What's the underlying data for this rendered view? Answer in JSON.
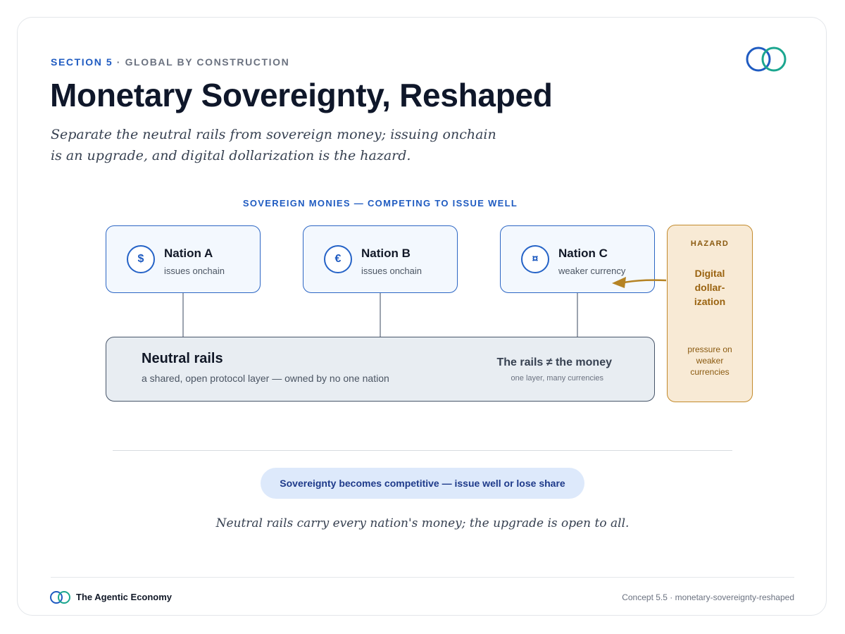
{
  "header": {
    "section": "SECTION 5",
    "separator": " · ",
    "section_name": "GLOBAL BY CONSTRUCTION",
    "title": "Monetary Sovereignty, Reshaped",
    "subtitle": "Separate the neutral rails from sovereign money; issuing onchain is an upgrade, and digital dollarization is the hazard."
  },
  "diagram": {
    "group_label": "SOVEREIGN MONIES — COMPETING TO ISSUE WELL",
    "nations": [
      {
        "symbol": "$",
        "name": "Nation A",
        "desc": "issues onchain"
      },
      {
        "symbol": "€",
        "name": "Nation B",
        "desc": "issues onchain"
      },
      {
        "symbol": "¤",
        "name": "Nation C",
        "desc": "weaker currency"
      }
    ],
    "rails": {
      "title": "Neutral rails",
      "desc": "a shared, open protocol layer — owned by no one nation",
      "note": "The rails ≠ the money",
      "note_sub": "one layer, many currencies"
    },
    "hazard": {
      "label": "HAZARD",
      "title": "Digital dollar-ization",
      "desc": "pressure on weaker currencies"
    }
  },
  "takeaway": {
    "pill": "Sovereignty becomes competitive — issue well or lose share",
    "closing": "Neutral rails carry every nation's money; the upgrade is open to all."
  },
  "footer": {
    "brand": "The Agentic Economy",
    "ref": "Concept 5.5 · monetary-sovereignty-reshaped"
  },
  "colors": {
    "accent_blue": "#1f5bc1",
    "accent_teal": "#1ba68f",
    "hazard_amber": "#c28a2c",
    "rails_slate": "#475569"
  },
  "icons": [
    "interlocking-rings-logo-icon",
    "dollar-coin-icon",
    "euro-coin-icon",
    "currency-coin-icon",
    "arrow-icon"
  ]
}
